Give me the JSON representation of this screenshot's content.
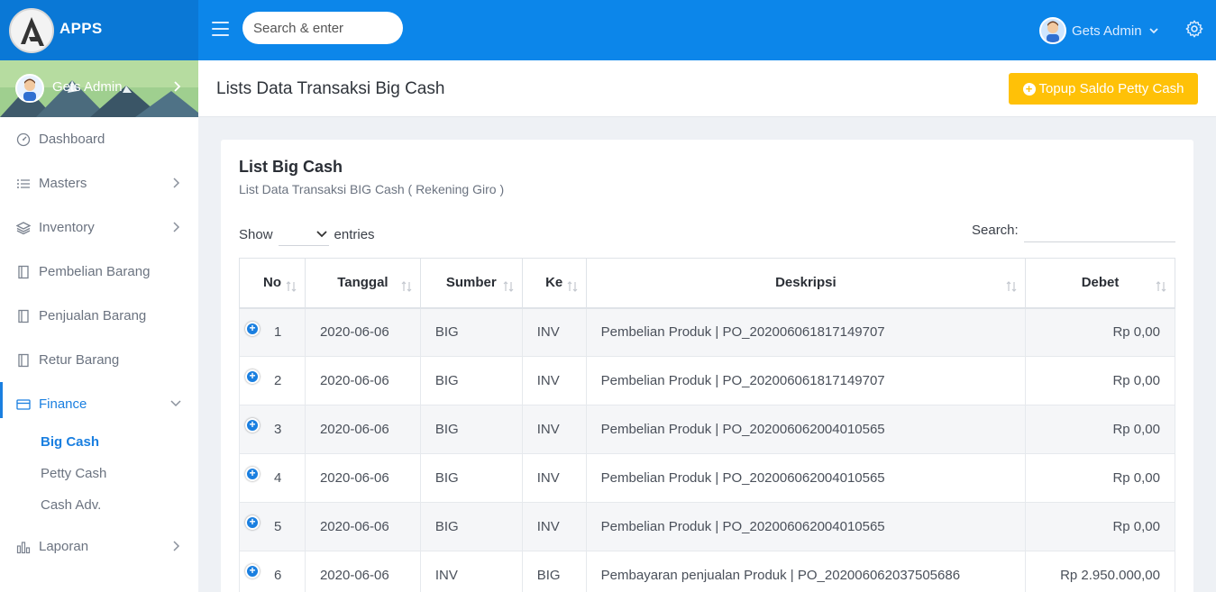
{
  "app": {
    "name": "APPS"
  },
  "topbar": {
    "search_placeholder": "Search & enter",
    "user_name": "Gets Admin"
  },
  "sidebar": {
    "profile_name": "Gets Admin",
    "items": [
      {
        "label": "Dashboard",
        "icon": "gauge-icon"
      },
      {
        "label": "Masters",
        "icon": "list-icon"
      },
      {
        "label": "Inventory",
        "icon": "layers-icon"
      },
      {
        "label": "Pembelian Barang",
        "icon": "notebook-icon"
      },
      {
        "label": "Penjualan Barang",
        "icon": "notebook-icon"
      },
      {
        "label": "Retur Barang",
        "icon": "notebook-icon"
      },
      {
        "label": "Finance",
        "icon": "credit-card-icon"
      },
      {
        "label": "Laporan",
        "icon": "bar-chart-icon"
      }
    ],
    "finance_sub": [
      "Big Cash",
      "Petty Cash",
      "Cash Adv."
    ]
  },
  "header": {
    "title": "Lists Data Transaksi Big Cash",
    "topup_label": "Topup Saldo Petty Cash"
  },
  "card": {
    "title": "List Big Cash",
    "subtitle": "List Data Transaksi BIG Cash ( Rekening Giro )",
    "show_label": "Show",
    "entries_label": "entries",
    "search_label": "Search:"
  },
  "table": {
    "columns": [
      "No",
      "Tanggal",
      "Sumber",
      "Ke",
      "Deskripsi",
      "Debet"
    ],
    "rows": [
      {
        "no": "1",
        "tanggal": "2020-06-06",
        "sumber": "BIG",
        "ke": "INV",
        "deskripsi": "Pembelian Produk | PO_202006061817149707",
        "debet": "Rp 0,00"
      },
      {
        "no": "2",
        "tanggal": "2020-06-06",
        "sumber": "BIG",
        "ke": "INV",
        "deskripsi": "Pembelian Produk | PO_202006061817149707",
        "debet": "Rp 0,00"
      },
      {
        "no": "3",
        "tanggal": "2020-06-06",
        "sumber": "BIG",
        "ke": "INV",
        "deskripsi": "Pembelian Produk | PO_202006062004010565",
        "debet": "Rp 0,00"
      },
      {
        "no": "4",
        "tanggal": "2020-06-06",
        "sumber": "BIG",
        "ke": "INV",
        "deskripsi": "Pembelian Produk | PO_202006062004010565",
        "debet": "Rp 0,00"
      },
      {
        "no": "5",
        "tanggal": "2020-06-06",
        "sumber": "BIG",
        "ke": "INV",
        "deskripsi": "Pembelian Produk | PO_202006062004010565",
        "debet": "Rp 0,00"
      },
      {
        "no": "6",
        "tanggal": "2020-06-06",
        "sumber": "INV",
        "ke": "BIG",
        "deskripsi": "Pembayaran penjualan Produk | PO_202006062037505686",
        "debet": "Rp 2.950.000,00"
      }
    ]
  },
  "colors": {
    "primary": "#0c86ea",
    "accent": "#1a7fe0",
    "warning": "#ffc107"
  }
}
